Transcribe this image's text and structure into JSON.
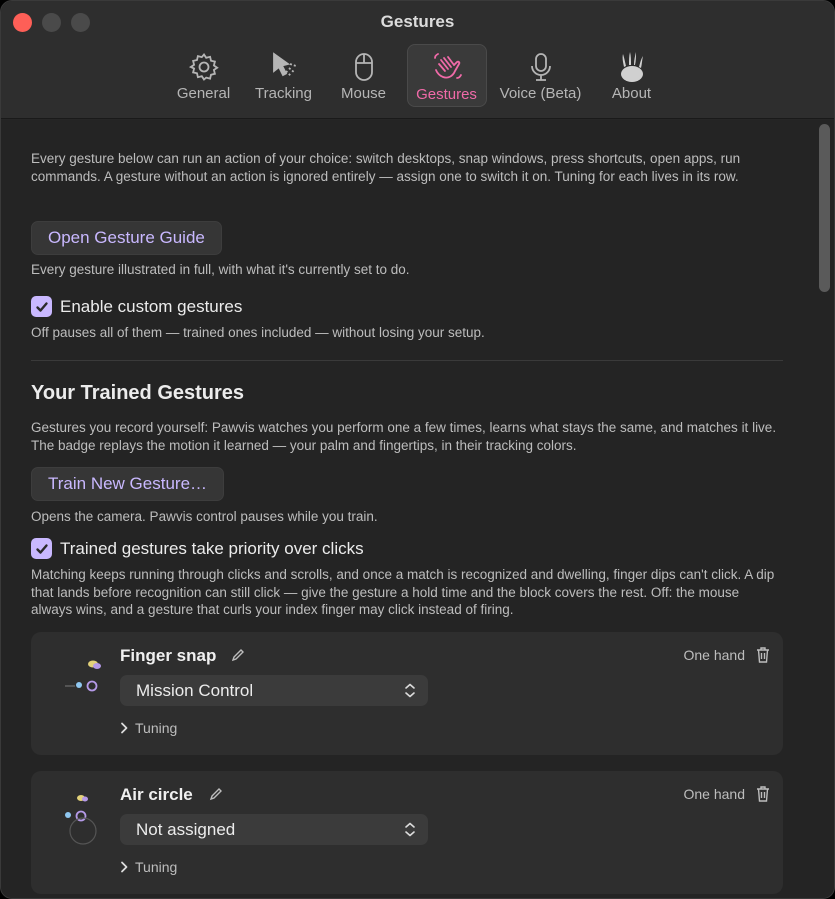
{
  "window": {
    "title": "Gestures"
  },
  "tabs": [
    {
      "id": "general",
      "label": "General",
      "icon": "gear-icon"
    },
    {
      "id": "tracking",
      "label": "Tracking",
      "icon": "cursor-arrows-icon"
    },
    {
      "id": "mouse",
      "label": "Mouse",
      "icon": "mouse-icon"
    },
    {
      "id": "gestures",
      "label": "Gestures",
      "icon": "waving-hand-icon",
      "active": true
    },
    {
      "id": "voice",
      "label": "Voice (Beta)",
      "icon": "microphone-icon"
    },
    {
      "id": "about",
      "label": "About",
      "icon": "paw-icon"
    }
  ],
  "intro": {
    "text": "Every gesture below can run an action of your choice: switch desktops, snap windows, press shortcuts, open apps, run commands. A gesture without an action is ignored entirely — assign one to switch it on. Tuning for each lives in its row.",
    "guide_button": "Open Gesture Guide",
    "guide_caption": "Every gesture illustrated in full, with what it's currently set to do."
  },
  "enable_custom": {
    "label": "Enable custom gestures",
    "checked": true,
    "caption": "Off pauses all of them — trained ones included — without losing your setup."
  },
  "trained": {
    "heading": "Your Trained Gestures",
    "text": "Gestures you record yourself: Pawvis watches you perform one a few times, learns what stays the same, and matches it live. The badge replays the motion it learned — your palm and fingertips, in their tracking colors.",
    "train_button": "Train New Gesture…",
    "train_caption": "Opens the camera. Pawvis control pauses while you train."
  },
  "priority": {
    "label": "Trained gestures take priority over clicks",
    "checked": true,
    "caption": "Matching keeps running through clicks and scrolls, and once a match is recognized and dwelling, finger dips can't click. A dip that lands before recognition can still click — give the gesture a hold time and the block covers the rest. Off: the mouse always wins, and a gesture that curls your index finger may click instead of firing."
  },
  "gestures": [
    {
      "name": "Finger snap",
      "scope": "One hand",
      "action": "Mission Control",
      "tuning": "Tuning"
    },
    {
      "name": "Air circle",
      "scope": "One hand",
      "action": "Not assigned",
      "tuning": "Tuning"
    }
  ],
  "colors": {
    "accent": "#c9b8ff",
    "active_tab": "#f06aa8"
  }
}
